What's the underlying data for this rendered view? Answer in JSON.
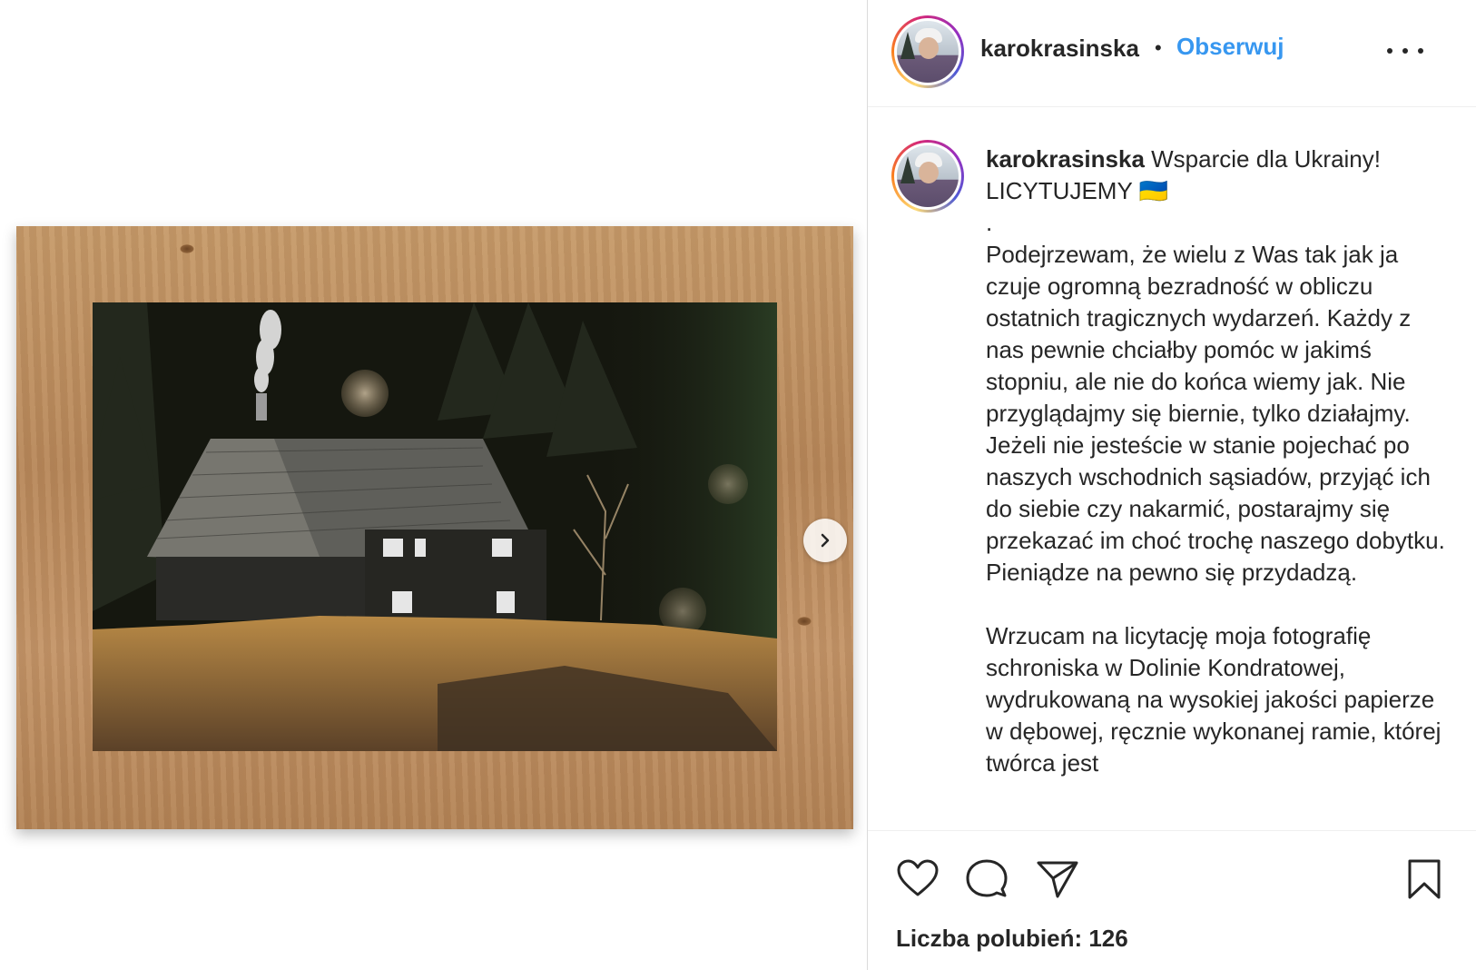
{
  "post": {
    "username": "karokrasinska",
    "follow_label": "Obserwuj",
    "separator": "•",
    "caption_title": "Wsparcie dla Ukrainy! LICYTUJEMY 🇺🇦",
    "caption_body": ".\nPodejrzewam, że wielu z Was tak jak ja czuje ogromną bezradność w obliczu ostatnich tragicznych wydarzeń. Każdy z nas pewnie chciałby pomóc w jakimś stopniu, ale nie do końca wiemy jak. Nie przyglądajmy się biernie, tylko działajmy. Jeżeli nie jesteście w stanie pojechać po naszych wschodnich sąsiadów, przyjąć ich do siebie czy nakarmić, postarajmy się przekazać im choć trochę naszego dobytku. Pieniądze na pewno się przydadzą.\n\nWrzucam na licytację moja fotografię schroniska w Dolinie Kondratowej, wydrukowaną na wysokiej jakości papierze w dębowej, ręcznie wykonanej ramie, której twórca jest",
    "likes_text": "Liczba polubień: 126"
  },
  "icons": {
    "more": "more-options-icon",
    "next": "chevron-right-icon",
    "like": "heart-icon",
    "comment": "comment-icon",
    "share": "send-icon",
    "save": "bookmark-icon"
  },
  "colors": {
    "follow": "#3797f0",
    "text": "#262626",
    "border": "#dbdbdb"
  }
}
